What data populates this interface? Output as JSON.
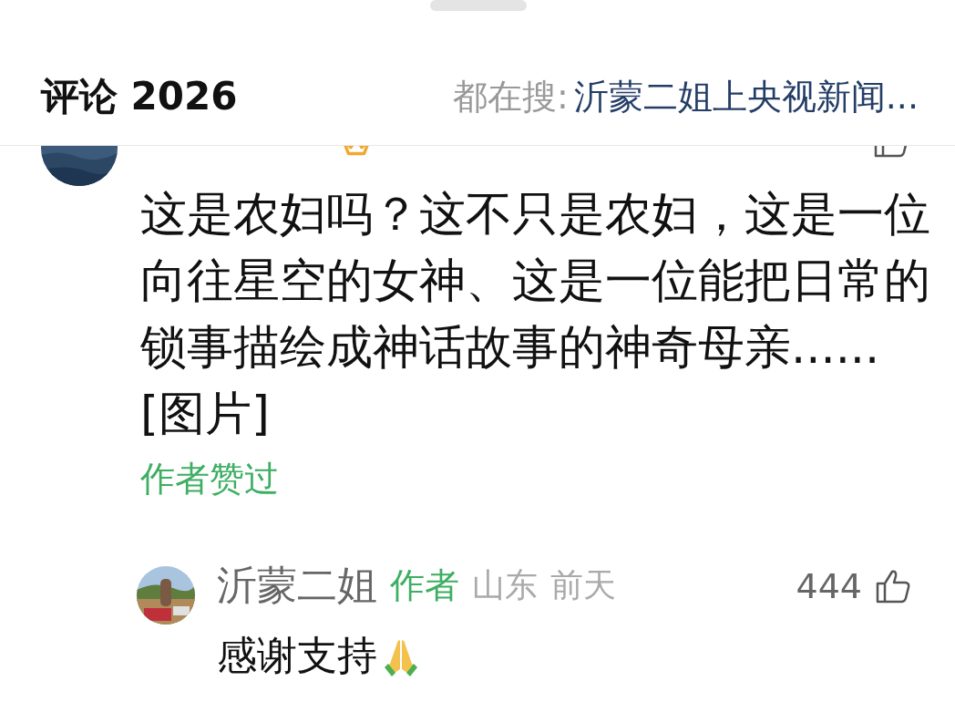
{
  "header": {
    "title": "评论 2026",
    "trending_label": "都在搜:",
    "trending_link": "沂蒙二姐上央视新闻..."
  },
  "comment": {
    "text": "这是农妇吗？这不只是农妇，这是一位向往星空的女神、这是一位能把日常的锁事描绘成神话故事的神奇母亲......[图片]",
    "author_liked": "作者赞过"
  },
  "reply": {
    "name": "沂蒙二姐",
    "badge": "作者",
    "location": "山东",
    "time": "前天",
    "likes": "444",
    "text": "感谢支持"
  }
}
